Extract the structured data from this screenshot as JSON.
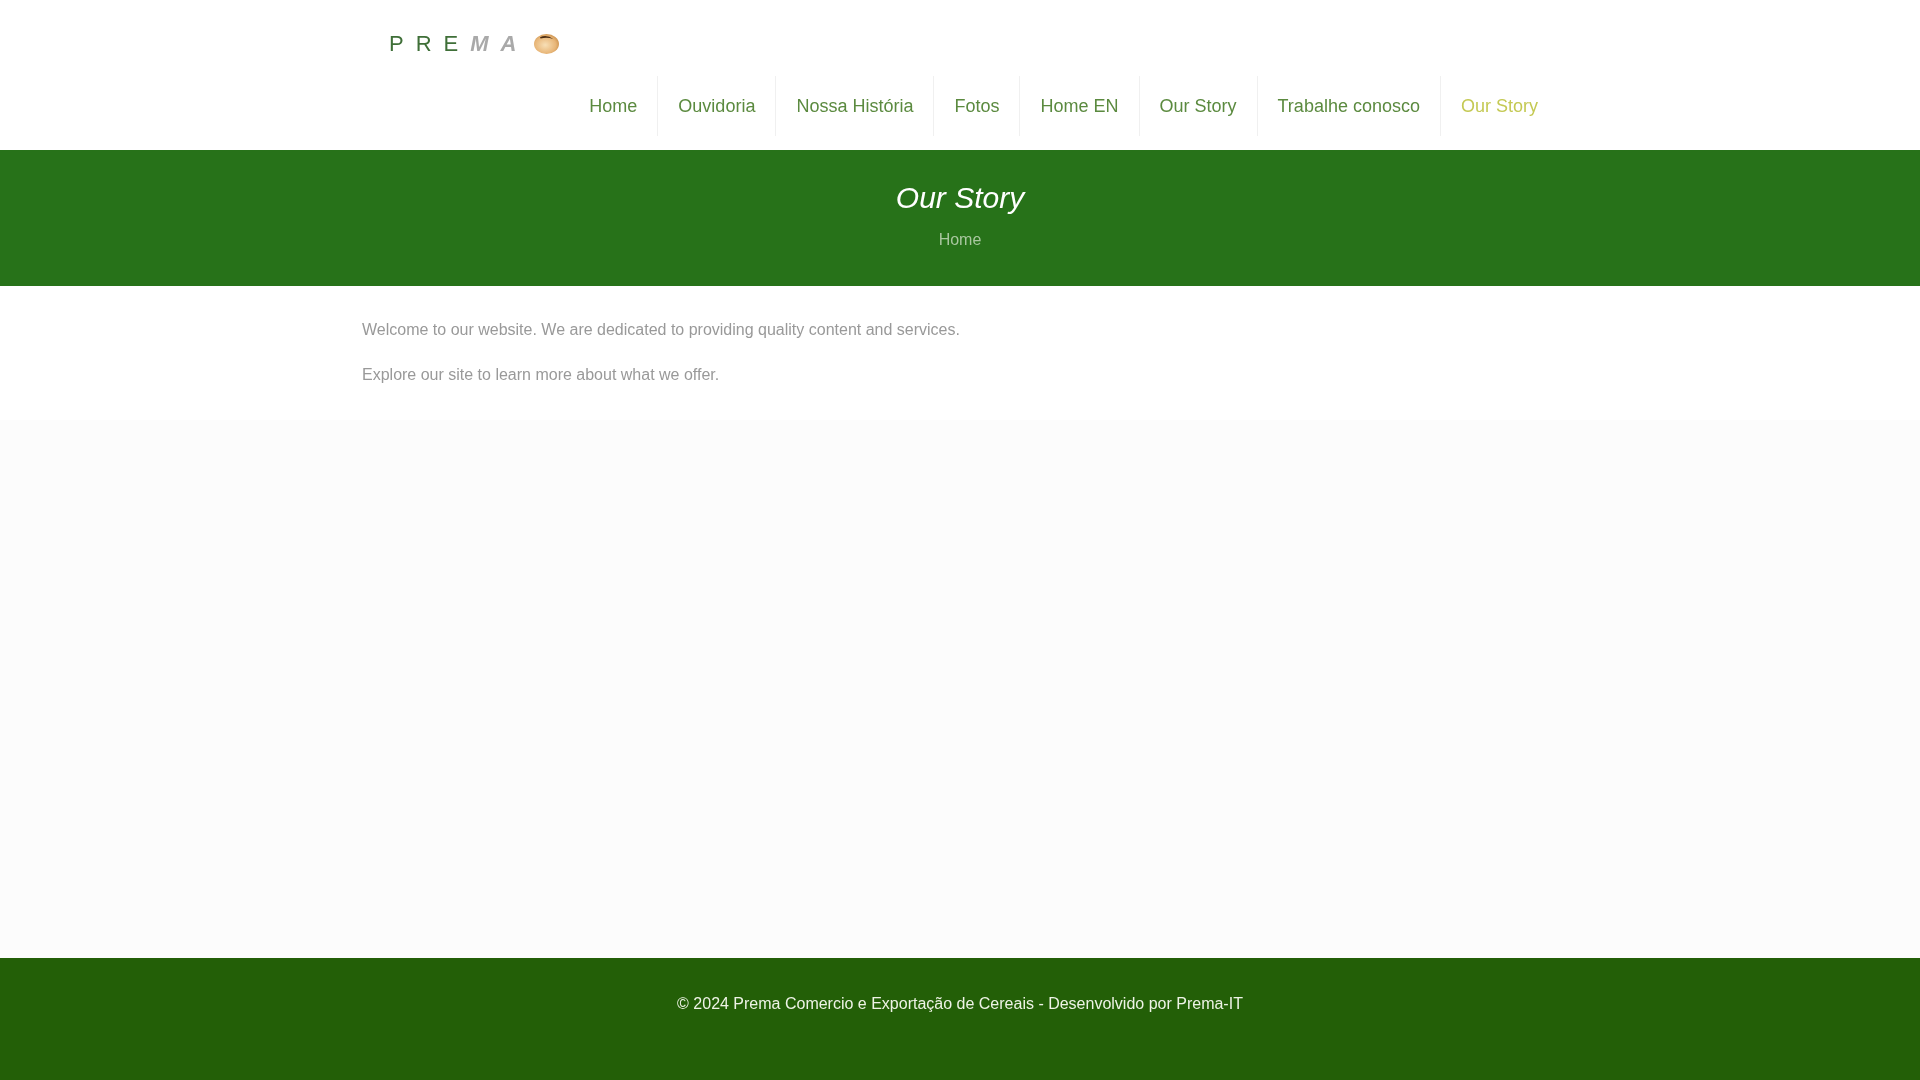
{
  "logo": {
    "parts": [
      {
        "text": "PRE",
        "kind": "line"
      },
      {
        "text": "MA",
        "kind": "solid"
      }
    ]
  },
  "nav": {
    "items": [
      {
        "label": "Home",
        "selected": false
      },
      {
        "label": "Ouvidoria",
        "selected": false
      },
      {
        "label": "Nossa História",
        "selected": false
      },
      {
        "label": "Fotos",
        "selected": false
      },
      {
        "label": "Home EN",
        "selected": false
      },
      {
        "label": "Our Story",
        "selected": false
      },
      {
        "label": "Trabalhe conosco",
        "selected": false
      },
      {
        "label": "Our Story",
        "selected": true
      }
    ]
  },
  "page_header": {
    "title": "Our Story",
    "breadcrumb": [
      "Home"
    ]
  },
  "content": {
    "paragraphs": [
      "Welcome to our website. We are dedicated to providing quality content and services.",
      "Explore our site to learn more about what we offer."
    ]
  },
  "footer": {
    "text": "© 2024 Prema Comercio e Exportação de Cereais - Desenvolvido por Prema-IT"
  }
}
